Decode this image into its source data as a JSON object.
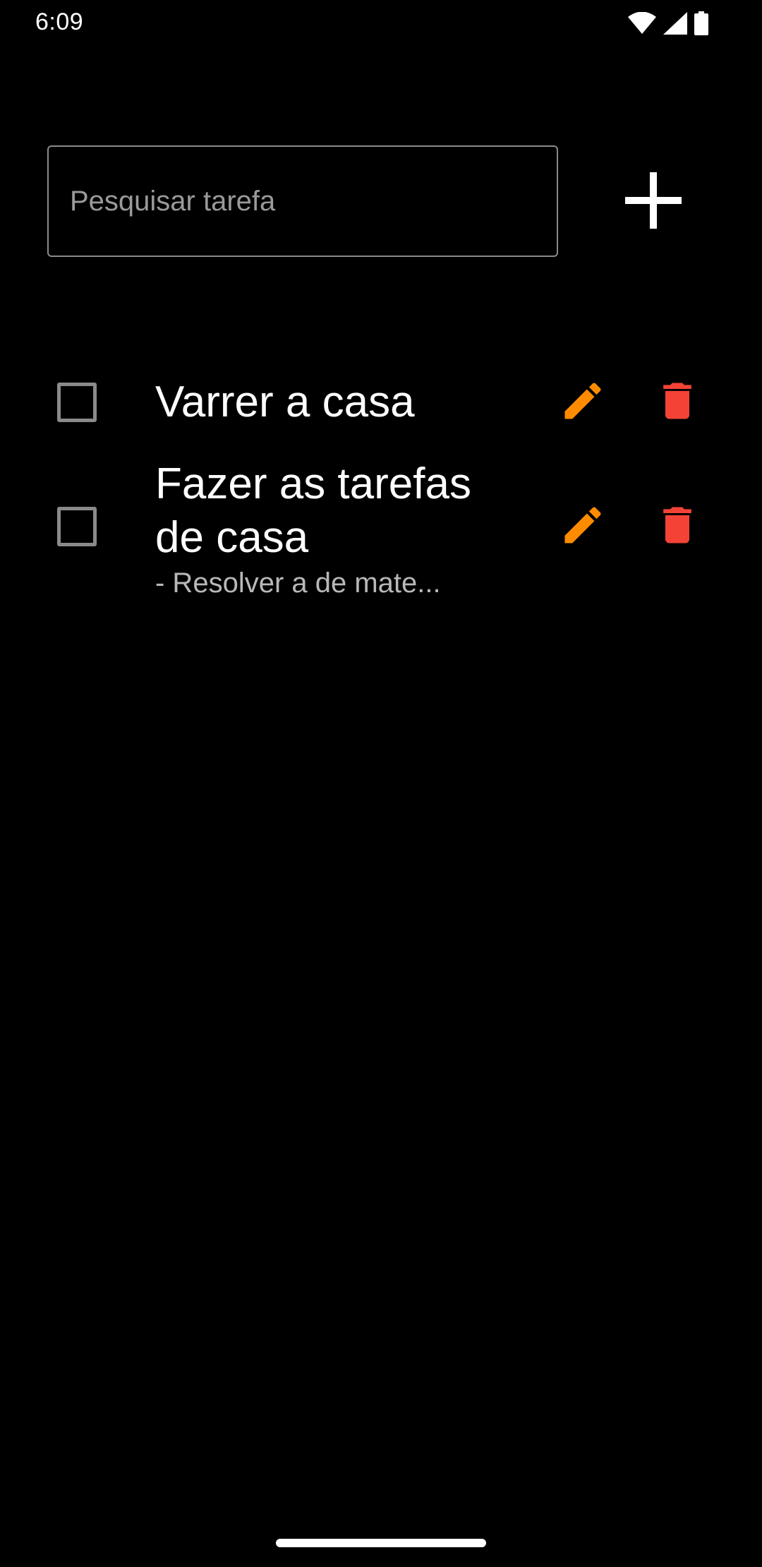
{
  "status_bar": {
    "time": "6:09",
    "icons": [
      "wifi-icon",
      "cellular-signal-icon",
      "battery-icon"
    ]
  },
  "search": {
    "placeholder": "Pesquisar tarefa",
    "value": ""
  },
  "add_button": {
    "icon": "plus-icon"
  },
  "tasks": [
    {
      "title": "Varrer a casa",
      "description": "",
      "checked": false,
      "edit_icon": "pencil-icon",
      "delete_icon": "trash-icon"
    },
    {
      "title": "Fazer as tarefas de casa",
      "description": "- Resolver a de mate...",
      "checked": false,
      "edit_icon": "pencil-icon",
      "delete_icon": "trash-icon"
    }
  ],
  "colors": {
    "background": "#000000",
    "edit_accent": "#FF8C00",
    "delete_accent": "#F44336",
    "checkbox_border": "#8A8A8A"
  }
}
